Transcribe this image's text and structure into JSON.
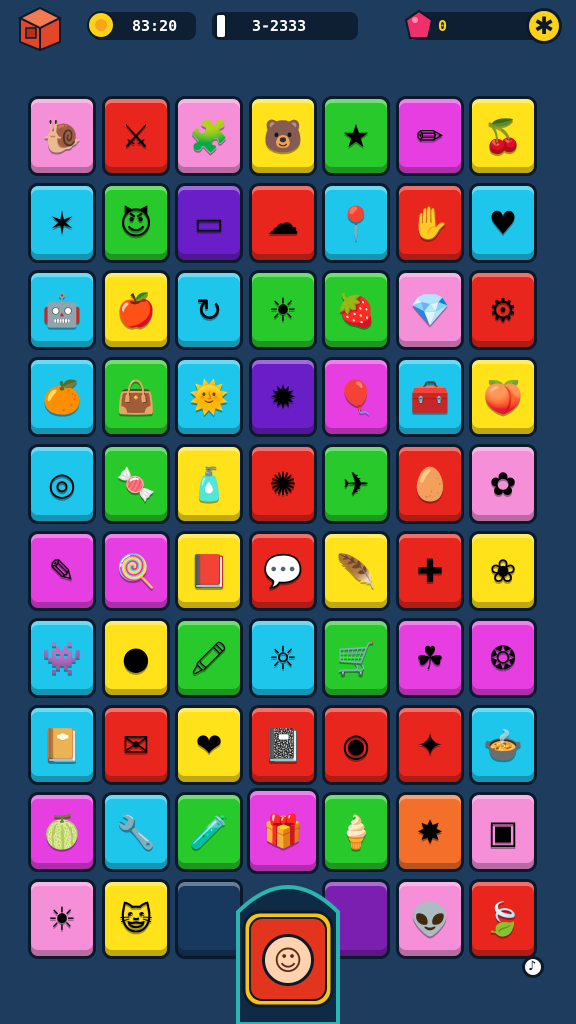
{
  "hud": {
    "timer_icon": "flower-icon",
    "timer": "83:20",
    "score_icon": "progress-marker-icon",
    "score": "3-2333",
    "gem_icon": "pink-gem-icon",
    "gems": "0",
    "menu_icon": "crate-icon",
    "add_icon": "asterisk-icon"
  },
  "colors": {
    "background": "#1e3d5e",
    "pink": "#f58fd8",
    "red": "#e8261e",
    "yellow": "#ffe21a",
    "green": "#28c92b",
    "cyan": "#1ec6ec",
    "purple": "#6a1ec8",
    "magenta": "#e63ee0",
    "orange": "#f4702a",
    "navy": "#17385f",
    "darkpurple": "#7b1fb0"
  },
  "board": {
    "rows": [
      [
        {
          "c": "pink",
          "i": "snail-icon",
          "g": "🐌"
        },
        {
          "c": "red",
          "i": "compass-icon",
          "g": "⚔"
        },
        {
          "c": "pink",
          "i": "green-box-icon",
          "g": "🧩"
        },
        {
          "c": "yellow",
          "i": "bear-face-icon",
          "g": "🐻"
        },
        {
          "c": "green",
          "i": "purple-star-icon",
          "g": "★"
        },
        {
          "c": "magenta",
          "i": "crayon-icon",
          "g": "✏"
        },
        {
          "c": "yellow",
          "i": "red-cherry-icon",
          "g": "🍒"
        }
      ],
      [
        {
          "c": "cyan",
          "i": "green-star-icon",
          "g": "✶"
        },
        {
          "c": "green",
          "i": "devil-face-icon",
          "g": "😈"
        },
        {
          "c": "purple",
          "i": "tape-icon",
          "g": "▭"
        },
        {
          "c": "red",
          "i": "cloud-icon",
          "g": "☁"
        },
        {
          "c": "cyan",
          "i": "pin-icon",
          "g": "📍"
        },
        {
          "c": "red",
          "i": "glove-icon",
          "g": "✋"
        },
        {
          "c": "cyan",
          "i": "purple-heart-icon",
          "g": "♥"
        }
      ],
      [
        {
          "c": "cyan",
          "i": "robot-face-icon",
          "g": "🤖"
        },
        {
          "c": "yellow",
          "i": "apple-icon",
          "g": "🍎"
        },
        {
          "c": "cyan",
          "i": "swirl-arrow-icon",
          "g": "↻"
        },
        {
          "c": "green",
          "i": "red-sun-icon",
          "g": "☀"
        },
        {
          "c": "green",
          "i": "strawberry-icon",
          "g": "🍓"
        },
        {
          "c": "pink",
          "i": "gem-icon",
          "g": "💎"
        },
        {
          "c": "red",
          "i": "green-gear-icon",
          "g": "⚙"
        }
      ],
      [
        {
          "c": "cyan",
          "i": "spiral-fruit-icon",
          "g": "🍊"
        },
        {
          "c": "green",
          "i": "green-bag-icon",
          "g": "👜"
        },
        {
          "c": "cyan",
          "i": "smiling-sun-icon",
          "g": "🌞"
        },
        {
          "c": "purple",
          "i": "pink-virus-icon",
          "g": "✹"
        },
        {
          "c": "magenta",
          "i": "yellow-balloon-icon",
          "g": "🎈"
        },
        {
          "c": "cyan",
          "i": "chest-icon",
          "g": "🧰"
        },
        {
          "c": "yellow",
          "i": "orange-fruit-icon",
          "g": "🍑"
        }
      ],
      [
        {
          "c": "cyan",
          "i": "yellow-ring-icon",
          "g": "◎"
        },
        {
          "c": "green",
          "i": "candy-icon",
          "g": "🍬"
        },
        {
          "c": "yellow",
          "i": "bottle-icon",
          "g": "🧴"
        },
        {
          "c": "red",
          "i": "blue-sun-icon",
          "g": "✺"
        },
        {
          "c": "green",
          "i": "paper-plane-icon",
          "g": "✈"
        },
        {
          "c": "red",
          "i": "green-egg-icon",
          "g": "🥚"
        },
        {
          "c": "pink",
          "i": "flower-icon",
          "g": "✿"
        }
      ],
      [
        {
          "c": "magenta",
          "i": "pencil-icon",
          "g": "✎"
        },
        {
          "c": "magenta",
          "i": "lollipop-icon",
          "g": "🍭"
        },
        {
          "c": "yellow",
          "i": "red-book-icon",
          "g": "📕"
        },
        {
          "c": "red",
          "i": "speech-bubble-icon",
          "g": "💬"
        },
        {
          "c": "yellow",
          "i": "feather-icon",
          "g": "🪶"
        },
        {
          "c": "red",
          "i": "plus-icon",
          "g": "✚"
        },
        {
          "c": "yellow",
          "i": "red-flower-icon",
          "g": "❀"
        }
      ],
      [
        {
          "c": "cyan",
          "i": "blue-monster-icon",
          "g": "👾"
        },
        {
          "c": "yellow",
          "i": "blue-ball-icon",
          "g": "●"
        },
        {
          "c": "green",
          "i": "marker-icon",
          "g": "🖍"
        },
        {
          "c": "cyan",
          "i": "orange-sun-icon",
          "g": "☼"
        },
        {
          "c": "green",
          "i": "cart-icon",
          "g": "🛒"
        },
        {
          "c": "magenta",
          "i": "clover-icon",
          "g": "☘"
        },
        {
          "c": "magenta",
          "i": "pink-sun-icon",
          "g": "❂"
        }
      ],
      [
        {
          "c": "cyan",
          "i": "red-notebook-icon",
          "g": "📔"
        },
        {
          "c": "red",
          "i": "envelope-icon",
          "g": "✉"
        },
        {
          "c": "yellow",
          "i": "heart-icon",
          "g": "❤"
        },
        {
          "c": "red",
          "i": "black-book-icon",
          "g": "📓"
        },
        {
          "c": "red",
          "i": "target-icon",
          "g": "◉"
        },
        {
          "c": "red",
          "i": "compass-badge-icon",
          "g": "✦"
        },
        {
          "c": "cyan",
          "i": "green-pot-icon",
          "g": "🍲"
        }
      ],
      [
        {
          "c": "magenta",
          "i": "green-strawberry-icon",
          "g": "🍈"
        },
        {
          "c": "cyan",
          "i": "wrench-icon",
          "g": "🔧"
        },
        {
          "c": "green",
          "i": "potion-icon",
          "g": "🧪"
        },
        {
          "c": "magenta",
          "i": "pink-gift-icon",
          "g": "🎁",
          "big": true
        },
        {
          "c": "green",
          "i": "popsicle-icon",
          "g": "🍦"
        },
        {
          "c": "orange",
          "i": "red-spark-icon",
          "g": "✸"
        },
        {
          "c": "pink",
          "i": "purple-box-icon",
          "g": "▣"
        }
      ],
      [
        {
          "c": "pink",
          "i": "orange-sun-small-icon",
          "g": "☀"
        },
        {
          "c": "yellow",
          "i": "cat-face-icon",
          "g": "😺"
        },
        {
          "c": "navy",
          "i": "empty-slot-icon",
          "g": ""
        },
        null,
        {
          "c": "darkpurple",
          "i": "empty-slot-icon",
          "g": ""
        },
        {
          "c": "pink",
          "i": "green-alien-icon",
          "g": "👽"
        },
        {
          "c": "red",
          "i": "leaf-icon",
          "g": "🍃"
        }
      ]
    ]
  },
  "dock": {
    "face_icon": "baby-face-icon",
    "face_glyph": "☺"
  },
  "corner_icon": "music-note-icon"
}
